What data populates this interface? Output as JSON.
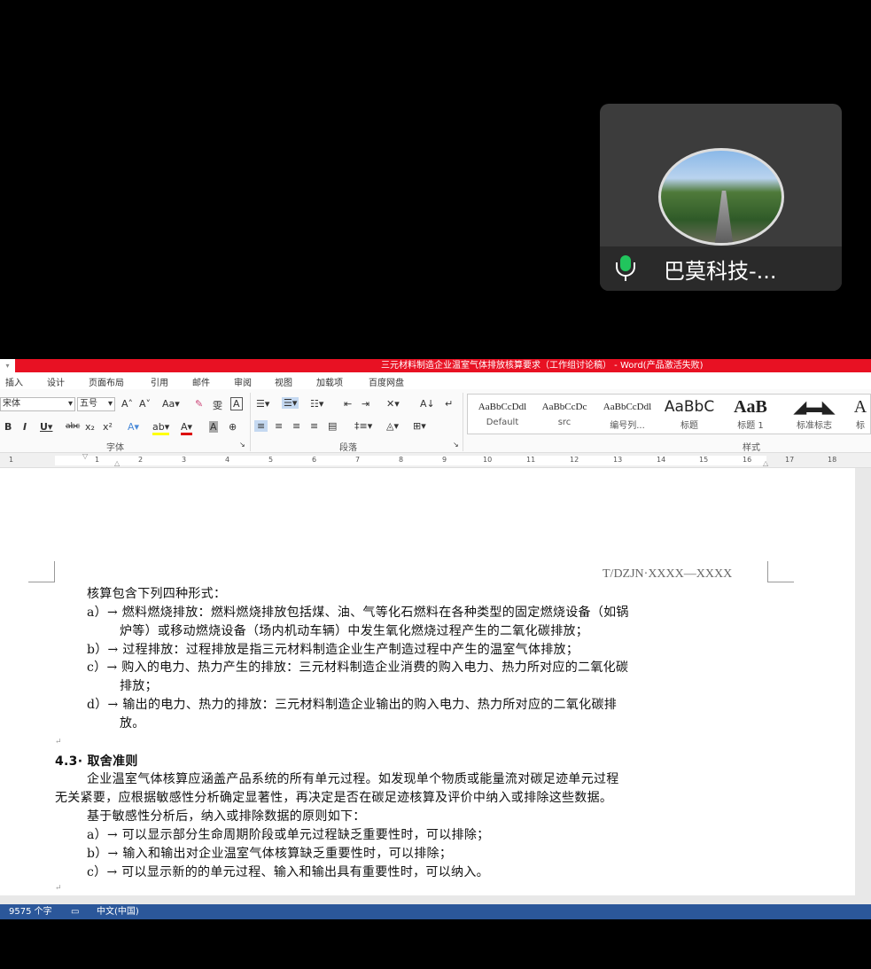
{
  "call": {
    "participant_name": "巴莫科技-...",
    "mic_icon": "microphone-icon",
    "mic_color": "#21c55d"
  },
  "word": {
    "title": "三元材料制造企业温室气体排放核算要求（工作组讨论稿） - Word(产品激活失败)",
    "title_color": "#e81123",
    "tabs": [
      "插入",
      "设计",
      "页面布局",
      "引用",
      "邮件",
      "审阅",
      "视图",
      "加载项",
      "百度网盘"
    ],
    "font_name": "宋体",
    "font_size": "五号",
    "groups": {
      "font": "字体",
      "paragraph": "段落",
      "styles": "样式"
    },
    "styles": [
      {
        "preview": "AaBbCcDdl",
        "label": "Default"
      },
      {
        "preview": "AaBbCcDc",
        "label": "src"
      },
      {
        "preview": "AaBbCcDdl",
        "label": "编号列..."
      },
      {
        "preview": "AaBbC",
        "label": "标题"
      },
      {
        "preview": "AaB",
        "label": "标题 1"
      },
      {
        "preview": "",
        "label": "标准标志"
      },
      {
        "preview": "A",
        "label": "标"
      }
    ],
    "ruler": [
      "1",
      "1",
      "2",
      "3",
      "4",
      "5",
      "6",
      "7",
      "8",
      "9",
      "10",
      "11",
      "12",
      "13",
      "14",
      "15",
      "16",
      "17",
      "18"
    ],
    "header": "T/DZJN·XXXX—XXXX",
    "lines": [
      "核算包含下列四种形式：",
      "a）→ 燃料燃烧排放：燃料燃烧排放包括煤、油、气等化石燃料在各种类型的固定燃烧设备（如锅",
      "炉等）或移动燃烧设备（场内机动车辆）中发生氧化燃烧过程产生的二氧化碳排放；",
      "b）→ 过程排放：过程排放是指三元材料制造企业生产制造过程中产生的温室气体排放；",
      "c）→ 购入的电力、热力产生的排放：三元材料制造企业消费的购入电力、热力所对应的二氧化碳",
      "排放；",
      "d）→ 输出的电力、热力的排放：三元材料制造企业输出的购入电力、热力所对应的二氧化碳排",
      "放。",
      "",
      "4.3· 取舍准则",
      "企业温室气体核算应涵盖产品系统的所有单元过程。如发现单个物质或能量流对碳足迹单元过程",
      "无关紧要，应根据敏感性分析确定显著性，再决定是否在碳足迹核算及评价中纳入或排除这些数据。",
      "基于敏感性分析后，纳入或排除数据的原则如下：",
      "a）→ 可以显示部分生命周期阶段或单元过程缺乏重要性时，可以排除；",
      "b）→ 输入和输出对企业温室气体核算缺乏重要性时，可以排除；",
      "c）→ 可以显示新的的单元过程、输入和输出具有重要性时，可以纳入。",
      ""
    ],
    "status": {
      "word_count": "9575 个字",
      "language": "中文(中国)",
      "status_color": "#2b579a"
    }
  }
}
